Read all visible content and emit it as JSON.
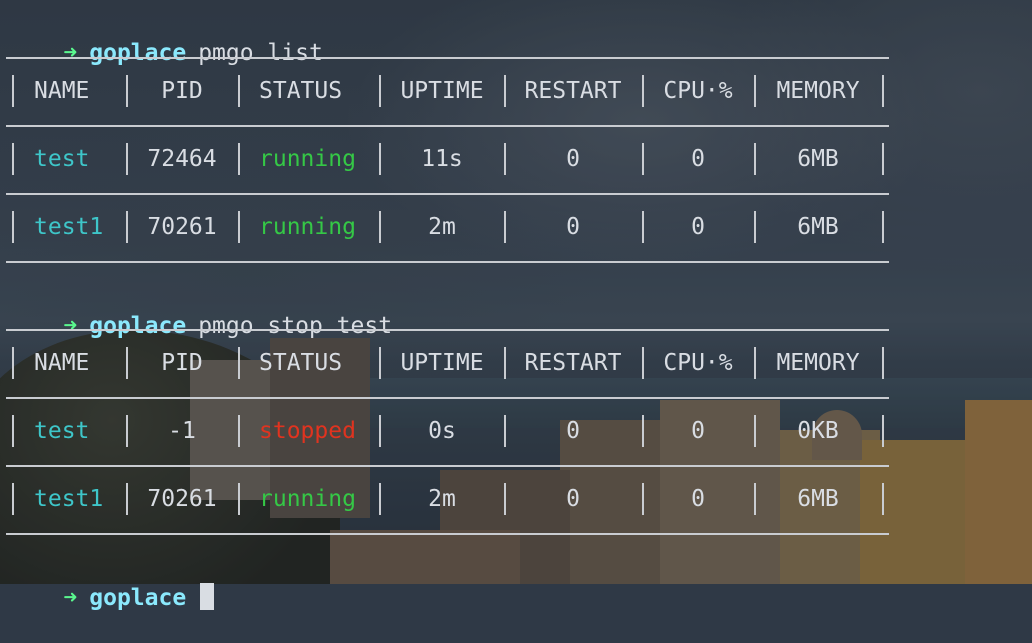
{
  "commands": [
    {
      "arrow": "➜",
      "dir": "goplace",
      "text": "pmgo list"
    },
    {
      "arrow": "➜",
      "dir": "goplace",
      "text": "pmgo stop test"
    },
    {
      "arrow": "➜",
      "dir": "goplace",
      "text": ""
    }
  ],
  "columns": [
    "NAME",
    "PID",
    "STATUS",
    "UPTIME",
    "RESTART",
    "CPU·%",
    "MEMORY"
  ],
  "table1": [
    {
      "name": "test",
      "pid": "72464",
      "status": "running",
      "uptime": "11s",
      "restart": "0",
      "cpu": "0",
      "memory": "6MB"
    },
    {
      "name": "test1",
      "pid": "70261",
      "status": "running",
      "uptime": "2m",
      "restart": "0",
      "cpu": "0",
      "memory": "6MB"
    }
  ],
  "table2": [
    {
      "name": "test",
      "pid": "-1",
      "status": "stopped",
      "uptime": "0s",
      "restart": "0",
      "cpu": "0",
      "memory": "0KB"
    },
    {
      "name": "test1",
      "pid": "70261",
      "status": "running",
      "uptime": "2m",
      "restart": "0",
      "cpu": "0",
      "memory": "6MB"
    }
  ],
  "colors": {
    "prompt_arrow": "#5af78e",
    "prompt_dir": "#8be9fd",
    "name": "#3ec6c9",
    "running": "#35c846",
    "stopped": "#e0331f"
  }
}
